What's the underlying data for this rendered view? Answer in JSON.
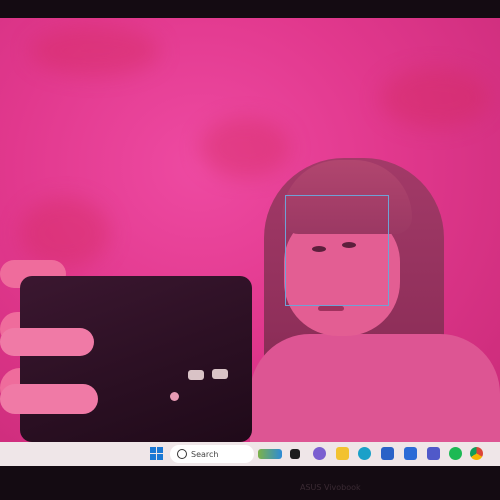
{
  "taskbar": {
    "search_label": "Search",
    "icons": [
      "windows-start-icon",
      "search-icon",
      "widgets-icon",
      "file-explorer-icon",
      "teams-chat-icon",
      "folder-icon",
      "edge-icon",
      "store-icon",
      "code-editor-icon",
      "teams-icon",
      "spotify-icon",
      "chrome-icon"
    ]
  },
  "bezel": {
    "brand_text": "ASUS Vivobook"
  },
  "colors": {
    "face_box": "#6fa2d6",
    "taskbar_bg": "#efe6e8",
    "windows_blue": "#1a78d4"
  }
}
